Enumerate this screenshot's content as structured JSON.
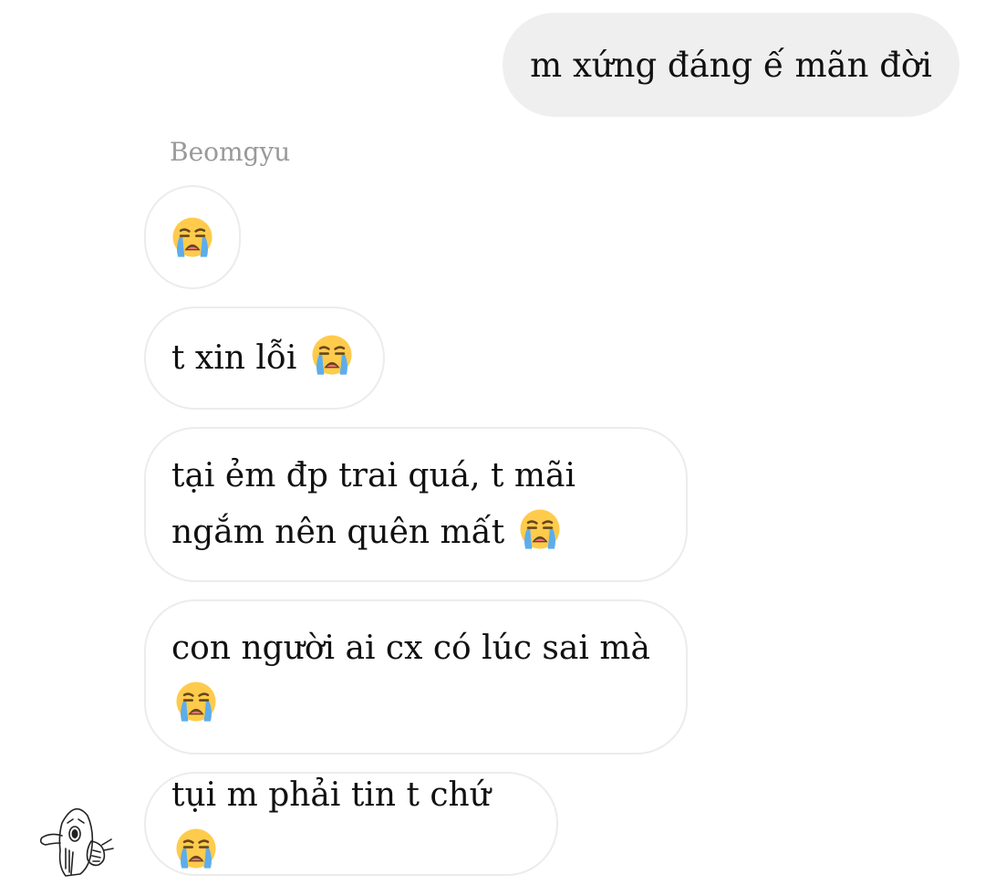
{
  "outgoing": {
    "text": "m xứng đáng ế mãn đời"
  },
  "incoming": {
    "sender_name": "Beomgyu",
    "messages": [
      {
        "text": "",
        "emoji": "loudly-crying-face"
      },
      {
        "text": "t xin lỗi ",
        "emoji": "loudly-crying-face"
      },
      {
        "text": "tại ẻm đp trai quá, t mãi ngắm nên quên mất ",
        "emoji": "loudly-crying-face"
      },
      {
        "text": "con người ai cx có lúc sai mà ",
        "emoji": "loudly-crying-face"
      },
      {
        "text": "tụi m phải tin t chứ ",
        "emoji": "loudly-crying-face"
      }
    ]
  },
  "colors": {
    "outgoing_bubble": "#efefef",
    "incoming_border": "#ececec",
    "sender_name": "#9a9a9a",
    "emoji_face": "#ffcb4c",
    "emoji_tears": "#5dadec"
  }
}
